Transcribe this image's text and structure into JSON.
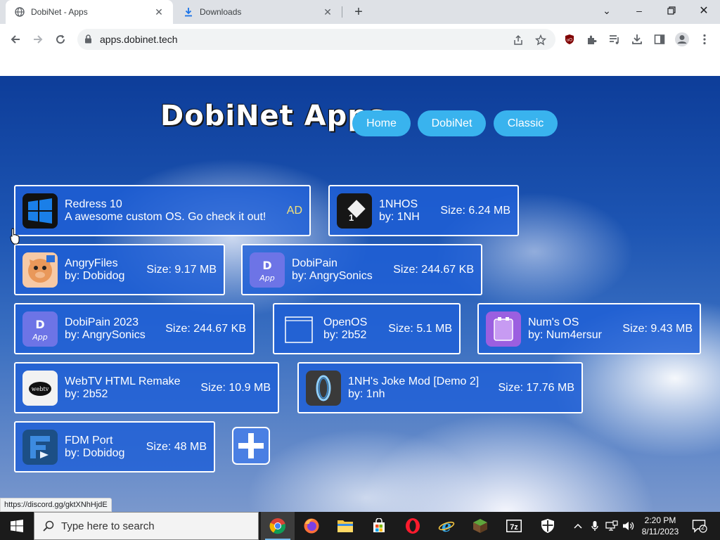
{
  "browser": {
    "tabs": [
      {
        "title": "DobiNet - Apps",
        "icon": "globe-icon"
      },
      {
        "title": "Downloads",
        "icon": "download-icon"
      }
    ],
    "url": "apps.dobinet.tech"
  },
  "page": {
    "logo": "DobiNet Apps",
    "nav": [
      "Home",
      "DobiNet",
      "Classic"
    ],
    "apps": [
      {
        "name": "Redress 10",
        "subtitle": "A awesome custom OS. Go check it out!",
        "badge": "AD"
      },
      {
        "name": "1NHOS",
        "subtitle": "by: 1NH",
        "size": "Size: 6.24 MB"
      },
      {
        "name": "AngryFiles",
        "subtitle": "by: Dobidog",
        "size": "Size: 9.17 MB"
      },
      {
        "name": "DobiPain",
        "subtitle": "by: AngrySonics",
        "size": "Size: 244.67 KB"
      },
      {
        "name": "DobiPain 2023",
        "subtitle": "by: AngrySonics",
        "size": "Size: 244.67 KB"
      },
      {
        "name": "OpenOS",
        "subtitle": "by: 2b52",
        "size": "Size: 5.1 MB"
      },
      {
        "name": "Num's OS",
        "subtitle": "by: Num4ersur",
        "size": "Size: 9.43 MB"
      },
      {
        "name": "WebTV HTML Remake",
        "subtitle": "by: 2b52",
        "size": "Size: 10.9 MB"
      },
      {
        "name": "1NH's Joke Mod [Demo 2]",
        "subtitle": "by: 1nh",
        "size": "Size: 17.76 MB"
      },
      {
        "name": "FDM Port",
        "subtitle": "by: Dobidog",
        "size": "Size: 48 MB"
      }
    ]
  },
  "status_url": "https://discord.gg/gktXNhHjdE",
  "taskbar": {
    "search_placeholder": "Type here to search",
    "time": "2:20 PM",
    "date": "8/11/2023",
    "notification_count": "2"
  },
  "colors": {
    "card_bg": "#1e5fd7",
    "nav_button": "#39b3ee",
    "ad_text": "#f4e27a",
    "taskbar": "#1b1b1b"
  }
}
